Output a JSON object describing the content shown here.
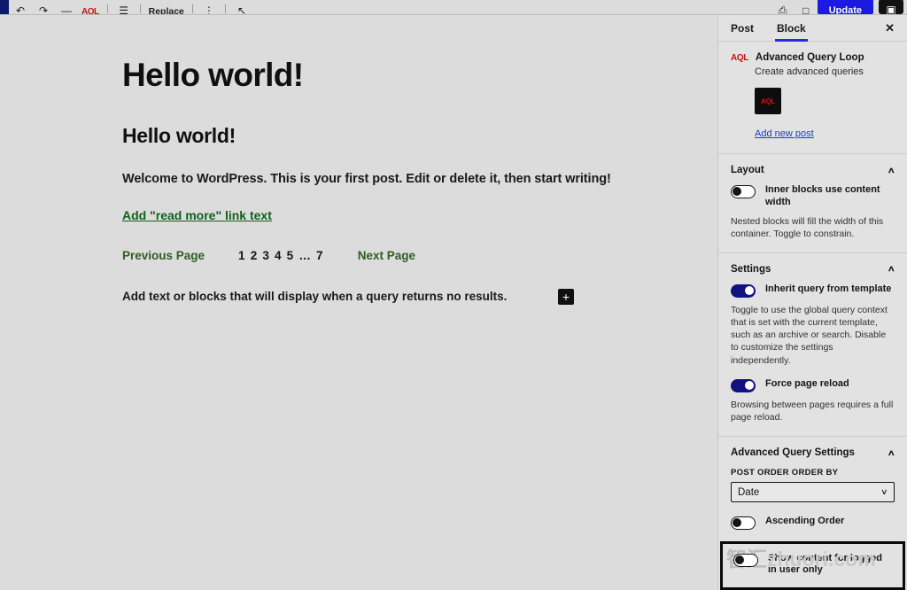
{
  "toolbar": {
    "left_items": [
      {
        "name": "undo-icon",
        "glyph": "↶"
      },
      {
        "name": "redo-icon",
        "glyph": "↷"
      },
      {
        "name": "minus-icon",
        "glyph": "—"
      },
      {
        "name": "aql-logo",
        "glyph": "AQL"
      },
      {
        "name": "list-view-icon",
        "glyph": "☰"
      },
      {
        "name": "replace-button",
        "glyph": "Replace"
      },
      {
        "name": "more-options-icon",
        "glyph": "⋮"
      },
      {
        "name": "collapse-icon",
        "glyph": "↖"
      }
    ],
    "right_items": [
      {
        "name": "preview-icon",
        "glyph": "⎙"
      },
      {
        "name": "view-icon",
        "glyph": "□"
      }
    ],
    "update_label": "Update",
    "settings_icon": "▣"
  },
  "canvas": {
    "heading_large": "Hello world!",
    "heading_small": "Hello world!",
    "paragraph": "Welcome to WordPress. This is your first post. Edit or delete it, then start writing!",
    "read_more_link": "Add \"read more\" link text",
    "pagination": {
      "previous_label": "Previous Page",
      "numbers": "1 2 3 4 5 … 7",
      "next_label": "Next Page"
    },
    "no_results_text": "Add text or blocks that will display when a query returns no results.",
    "add_block_glyph": "+"
  },
  "sidebar": {
    "tabs": [
      {
        "label": "Post",
        "active": false
      },
      {
        "label": "Block",
        "active": true
      }
    ],
    "close_glyph": "✕",
    "block_card": {
      "mark": "AQL",
      "title": "Advanced Query Loop",
      "subtitle": "Create advanced queries",
      "thumb_text": "AQL",
      "add_new_post_link": "Add new post"
    },
    "layout_section": {
      "title": "Layout",
      "chevron": "∧",
      "toggle_label": "Inner blocks use content width",
      "toggle_state": "off",
      "help": "Nested blocks will fill the width of this container. Toggle to constrain."
    },
    "settings_section": {
      "title": "Settings",
      "chevron": "∧",
      "inherit_label": "Inherit query from template",
      "inherit_state": "on",
      "inherit_help": "Toggle to use the global query context that is set with the current template, such as an archive or search. Disable to customize the settings independently.",
      "reload_label": "Force page reload",
      "reload_state": "on",
      "reload_help": "Browsing between pages requires a full page reload."
    },
    "advanced_section": {
      "title": "Advanced Query Settings",
      "chevron": "∧",
      "order_by_label": "POST ORDER ORDER BY",
      "order_by_value": "Date",
      "order_by_chevron": "∨",
      "ascending_label": "Ascending Order",
      "ascending_state": "off",
      "logged_in_label": "Show content for logged in user only",
      "logged_in_state": "off"
    }
  },
  "watermark": {
    "cjk": "智汇",
    "latin": "zhuori.com"
  },
  "colors": {
    "accent_blue": "#2b2bd6",
    "toggle_on": "#12127e",
    "link_green": "#11601a",
    "aql_red": "#cc1111",
    "link_blue": "#1a3fd0"
  }
}
